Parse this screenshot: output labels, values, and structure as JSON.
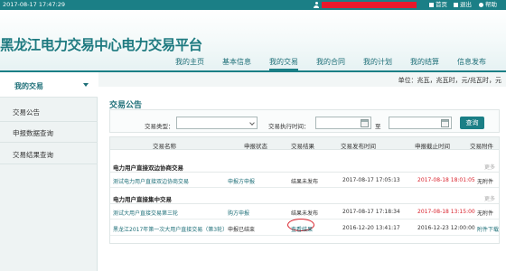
{
  "topbar": {
    "datetime": "2017-08-17 17:47:29",
    "links": [
      {
        "label": "首页",
        "icon": "home-icon"
      },
      {
        "label": "退出",
        "icon": "logout-icon"
      },
      {
        "label": "帮助",
        "icon": "help-icon"
      }
    ],
    "redaction_color": "#e8192c"
  },
  "header": {
    "title": "黑龙江电力交易中心电力交易平台",
    "nav": [
      "我的主页",
      "基本信息",
      "我的交易",
      "我的合同",
      "我的计划",
      "我的结算",
      "信息发布"
    ],
    "active_nav": "我的交易"
  },
  "sidebar": {
    "title": "我的交易",
    "items": [
      "交易公告",
      "申报数据查询",
      "交易结果查询"
    ]
  },
  "units_text": "单位：兆瓦，兆瓦时，元/兆瓦时，元",
  "section_title": "交易公告",
  "filters": {
    "type_label": "交易类型：",
    "type_value": "",
    "time_label": "交易执行时间：",
    "to_label": "至",
    "start_value": "",
    "end_value": "",
    "search_label": "查询"
  },
  "table": {
    "headers": [
      "交易名称",
      "申报状态",
      "交易结果",
      "交易发布时间",
      "申报截止时间",
      "交易附件"
    ],
    "more_label": "更多",
    "groups": [
      {
        "title": "电力用户直接双边协商交易",
        "rows": [
          {
            "name": "测试电力用户直接双边协商交易",
            "status": "申报方申报",
            "result": "结果未发布",
            "publish": "2017-08-17 17:05:13",
            "deadline": "2017-08-18 18:01:05",
            "attachment": "无附件",
            "deadline_red": true
          }
        ]
      },
      {
        "title": "电力用户直接集中交易",
        "rows": [
          {
            "name": "测试大用户直接交易第三轮",
            "status": "购方申报",
            "result": "结果未发布",
            "publish": "2017-08-17 17:18:34",
            "deadline": "2017-08-18 13:15:00",
            "attachment": "无附件",
            "deadline_red": true
          },
          {
            "name": "黑龙江2017年第一次大用户直接交易（第3轮）",
            "status": "申报已结束",
            "result": "查看结果",
            "publish": "2016-12-20 13:41:17",
            "deadline": "2016-12-23 12:00:00",
            "attachment": "附件下载",
            "deadline_red": false
          }
        ]
      }
    ]
  },
  "colors": {
    "accent": "#1b7f86",
    "link": "#1e6f78",
    "alert": "#d9232d"
  }
}
